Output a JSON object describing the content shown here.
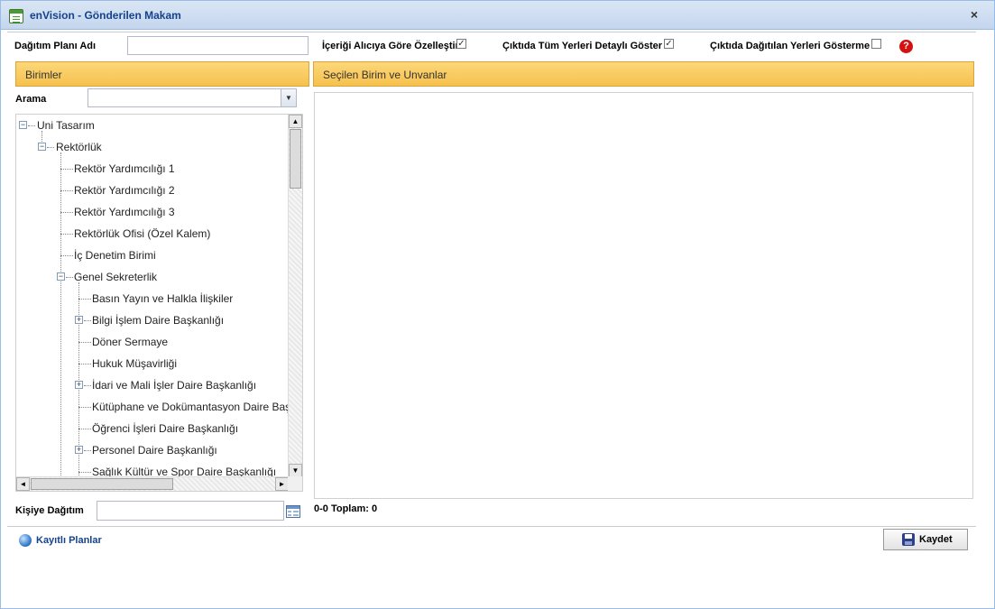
{
  "window": {
    "title": "enVision - Gönderilen Makam",
    "close_glyph": "×"
  },
  "topbar": {
    "plan_name_label": "Dağıtım Planı Adı",
    "plan_name_value": "",
    "customize_label": "İçeriği Alıcıya Göre Özelleştir",
    "customize_checked": true,
    "show_all_label": "Çıktıda Tüm Yerleri Detaylı Göster",
    "show_all_checked": true,
    "hide_distributed_label": "Çıktıda Dağıtılan Yerleri Gösterme",
    "hide_distributed_checked": false,
    "check_glyph": "✓",
    "help_glyph": "?"
  },
  "left_panel": {
    "header": "Birimler",
    "search_label": "Arama",
    "search_value": "",
    "combo_glyph": "▼",
    "tree": [
      {
        "label": "Uni Tasarım",
        "expander": "−"
      },
      {
        "label": "Rektörlük",
        "expander": "−"
      },
      {
        "label": "Rektör Yardımcılığı 1"
      },
      {
        "label": "Rektör Yardımcılığı 2"
      },
      {
        "label": "Rektör Yardımcılığı 3"
      },
      {
        "label": "Rektörlük Ofisi (Özel Kalem)"
      },
      {
        "label": "İç Denetim Birimi"
      },
      {
        "label": "Genel Sekreterlik",
        "expander": "−"
      },
      {
        "label": "Basın Yayın ve Halkla İlişkiler"
      },
      {
        "label": "Bilgi İşlem Daire Başkanlığı",
        "expander": "+"
      },
      {
        "label": "Döner Sermaye"
      },
      {
        "label": "Hukuk Müşavirliği"
      },
      {
        "label": "İdari ve Mali İşler Daire Başkanlığı",
        "expander": "+"
      },
      {
        "label": "Kütüphane ve Dokümantasyon Daire Başkanlığı"
      },
      {
        "label": "Öğrenci İşleri Daire Başkanlığı"
      },
      {
        "label": "Personel Daire Başkanlığı",
        "expander": "+"
      },
      {
        "label": "Sağlık Kültür ve Spor Daire Başkanlığı"
      }
    ],
    "scroll": {
      "up": "▲",
      "down": "▼",
      "left": "◄",
      "right": "►"
    }
  },
  "right_panel": {
    "header": "Seçilen Birim ve Unvanlar",
    "paging": "0-0 Toplam: 0"
  },
  "bottom": {
    "person_label": "Kişiye Dağıtım",
    "person_value": "",
    "saved_plans_link": "Kayıtlı Planlar",
    "save_button": "Kaydet"
  }
}
